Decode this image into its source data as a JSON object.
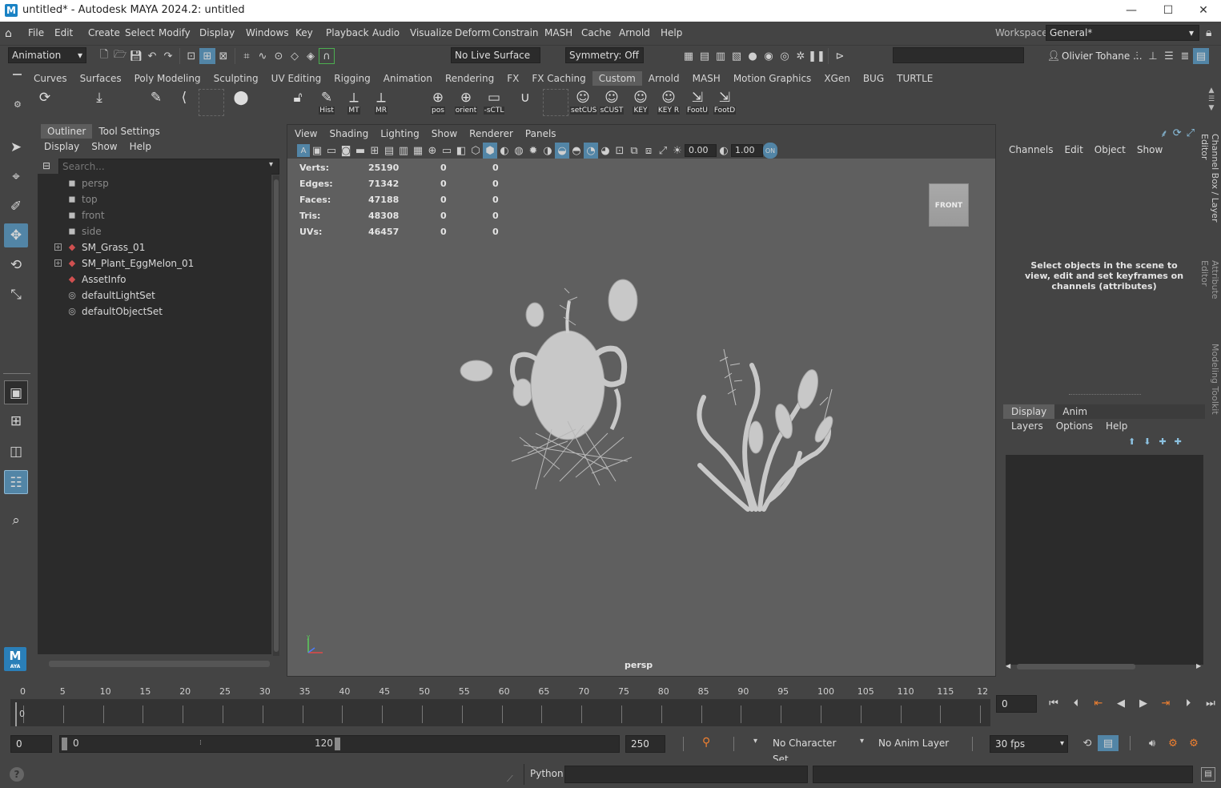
{
  "title": {
    "text": "untitled* - Autodesk MAYA 2024.2: untitled",
    "logo": "M",
    "minimize": "—",
    "maximize": "☐",
    "close": "✕"
  },
  "menubar": {
    "items": [
      "File",
      "Edit",
      "Create",
      "Select",
      "Modify",
      "Display",
      "Windows",
      "Key",
      "Playback",
      "Audio",
      "Visualize",
      "Deform",
      "Constrain",
      "MASH",
      "Cache",
      "Arnold",
      "Help"
    ],
    "workspace_label": "Workspace:",
    "workspace_value": "General*"
  },
  "statusline": {
    "menuset": "Animation",
    "live_surface": "No Live Surface",
    "symmetry": "Symmetry: Off",
    "user": "Olivier Tohane ..."
  },
  "shelf": {
    "tabs": [
      "Curves",
      "Surfaces",
      "Poly Modeling",
      "Sculpting",
      "UV Editing",
      "Rigging",
      "Animation",
      "Rendering",
      "FX",
      "FX Caching",
      "Custom",
      "Arnold",
      "MASH",
      "Motion Graphics",
      "XGen",
      "BUG",
      "TURTLE"
    ],
    "active_tab": "Custom",
    "buttons": [
      "Hist",
      "MT",
      "MR",
      "pos",
      "orient",
      "-sCTL",
      "setCUS",
      "sCUST",
      "KEY",
      "KEY R",
      "FootU",
      "FootD"
    ]
  },
  "outliner": {
    "tabs": [
      "Outliner",
      "Tool Settings"
    ],
    "menus": [
      "Display",
      "Show",
      "Help"
    ],
    "search_placeholder": "Search...",
    "rows": [
      {
        "label": "persp",
        "icon": "camera-icon",
        "dim": true
      },
      {
        "label": "top",
        "icon": "camera-icon",
        "dim": true
      },
      {
        "label": "front",
        "icon": "camera-icon",
        "dim": true
      },
      {
        "label": "side",
        "icon": "camera-icon",
        "dim": true
      },
      {
        "label": "SM_Grass_01",
        "icon": "mesh-icon",
        "expand": true
      },
      {
        "label": "SM_Plant_EggMelon_01",
        "icon": "mesh-icon",
        "expand": true
      },
      {
        "label": "AssetInfo",
        "icon": "mesh-icon"
      },
      {
        "label": "defaultLightSet",
        "icon": "set-icon"
      },
      {
        "label": "defaultObjectSet",
        "icon": "set-icon"
      }
    ]
  },
  "viewport": {
    "menus": [
      "View",
      "Shading",
      "Lighting",
      "Show",
      "Renderer",
      "Panels"
    ],
    "gamma": "0.00",
    "exposure": "1.00",
    "camera": "persp",
    "viewcube": "FRONT",
    "hud": [
      {
        "label": "Verts:",
        "a": "25190",
        "b": "0",
        "c": "0"
      },
      {
        "label": "Edges:",
        "a": "71342",
        "b": "0",
        "c": "0"
      },
      {
        "label": "Faces:",
        "a": "47188",
        "b": "0",
        "c": "0"
      },
      {
        "label": "Tris:",
        "a": "48308",
        "b": "0",
        "c": "0"
      },
      {
        "label": "UVs:",
        "a": "46457",
        "b": "0",
        "c": "0"
      }
    ]
  },
  "channelbox": {
    "menus": [
      "Channels",
      "Edit",
      "Object",
      "Show"
    ],
    "message": "Select objects in the scene to view, edit and set keyframes on channels (attributes)",
    "layer_tabs": [
      "Display",
      "Anim"
    ],
    "layer_menus": [
      "Layers",
      "Options",
      "Help"
    ],
    "side_tabs": [
      "Channel Box / Layer Editor",
      "Attribute Editor",
      "Modeling Toolkit"
    ]
  },
  "timeline": {
    "ticks": [
      "0",
      "5",
      "10",
      "15",
      "20",
      "25",
      "30",
      "35",
      "40",
      "45",
      "50",
      "55",
      "60",
      "65",
      "70",
      "75",
      "80",
      "85",
      "90",
      "95",
      "100",
      "105",
      "110",
      "115",
      "12"
    ],
    "current": "0",
    "current_field": "0"
  },
  "range": {
    "start": "0",
    "inner_start": "0",
    "inner_end": "120",
    "end": "250",
    "character_set": "No Character Set",
    "anim_layer": "No Anim Layer",
    "fps": "30 fps"
  },
  "cmdline": {
    "label": "Python",
    "help": "?"
  }
}
